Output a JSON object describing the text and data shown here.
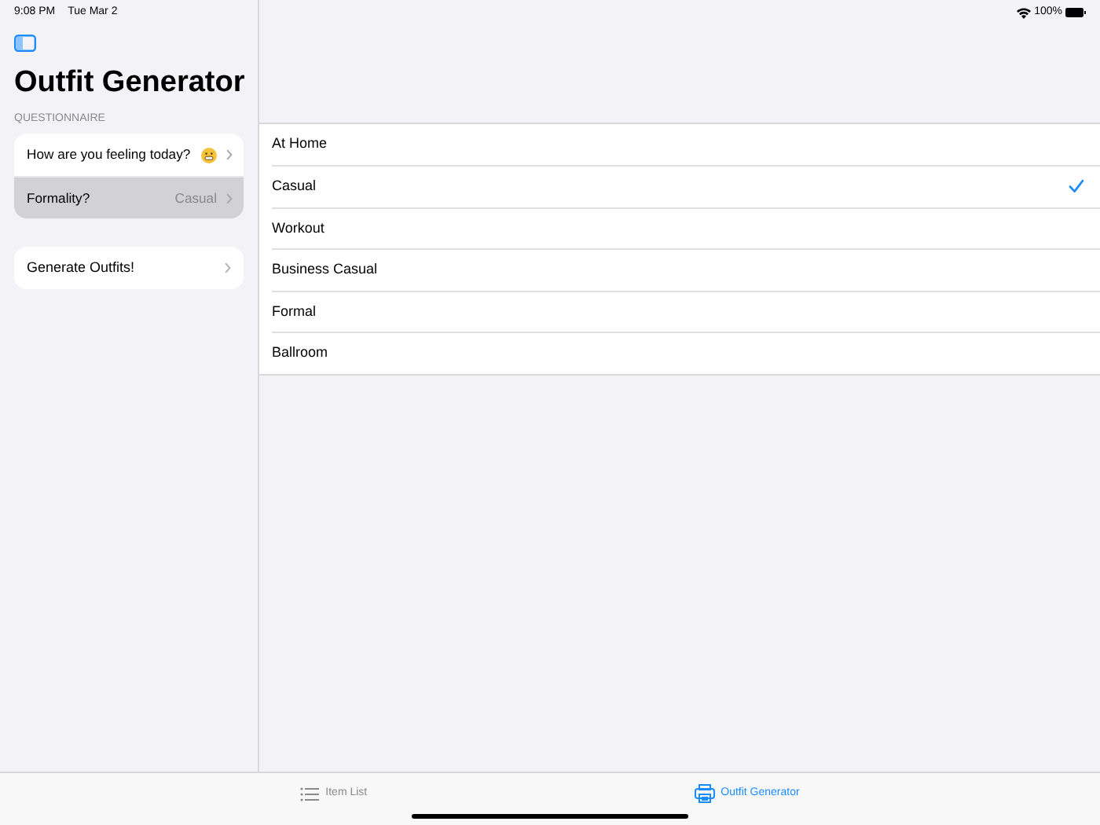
{
  "status_bar": {
    "time": "9:08 PM",
    "date": "Tue Mar 2",
    "battery": "100%"
  },
  "sidebar": {
    "title": "Outfit Generator",
    "section_header": "QUESTIONNAIRE",
    "questions": [
      {
        "label": "How are you feeling today?",
        "kind": "emoji",
        "selected": false
      },
      {
        "label": "Formality?",
        "kind": "value",
        "value": "Casual",
        "selected": true
      }
    ],
    "action": {
      "label": "Generate Outfits!"
    }
  },
  "options": [
    {
      "label": "At Home",
      "checked": false
    },
    {
      "label": "Casual",
      "checked": true
    },
    {
      "label": "Workout",
      "checked": false
    },
    {
      "label": "Business Casual",
      "checked": false
    },
    {
      "label": "Formal",
      "checked": false
    },
    {
      "label": "Ballroom",
      "checked": false
    }
  ],
  "tabs": [
    {
      "label": "Item List",
      "kind": "list",
      "selected": false
    },
    {
      "label": "Outfit Generator",
      "kind": "generator",
      "selected": true
    }
  ]
}
